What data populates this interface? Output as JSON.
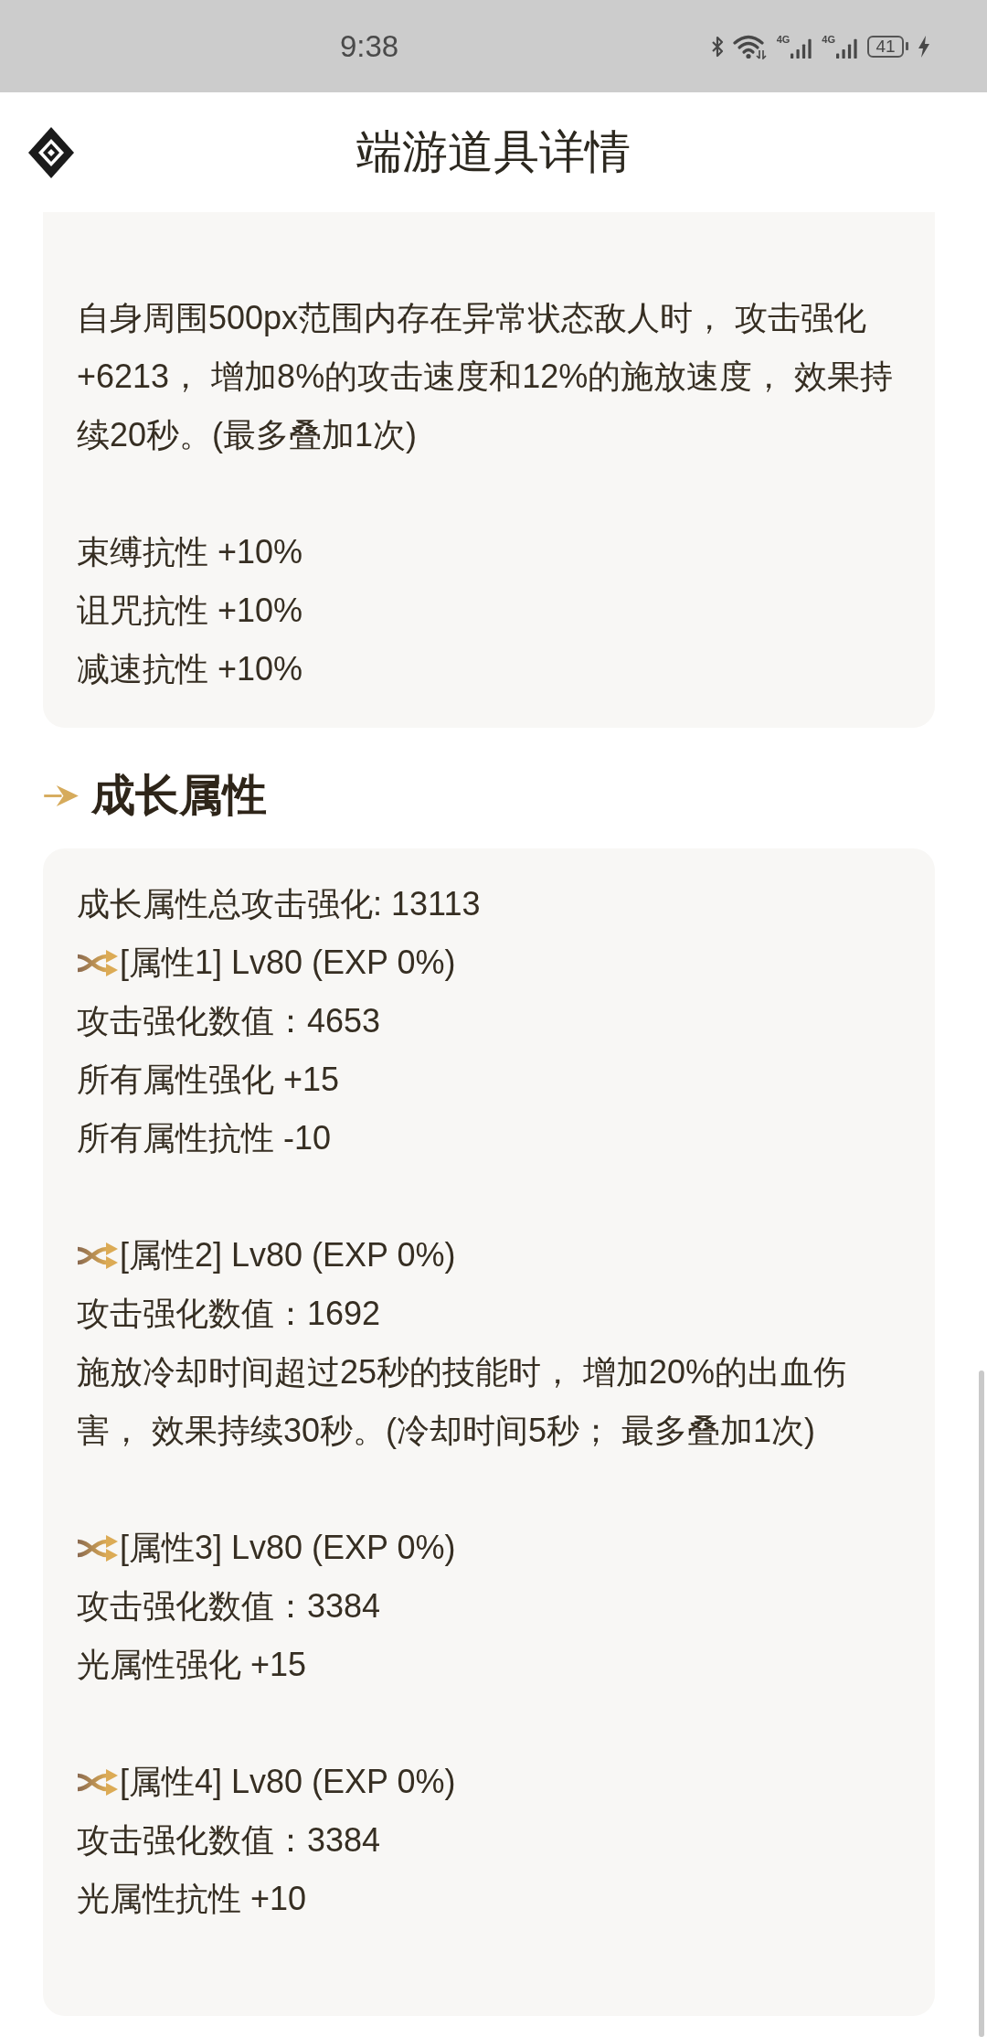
{
  "status_bar": {
    "time": "9:38",
    "signal_1_label": "4G",
    "signal_2_label": "4G",
    "battery": "41"
  },
  "header": {
    "title": "端游道具详情"
  },
  "effect_card": {
    "blocks": [
      {
        "lines": [
          "自身周围500px范围内存在异常状态敌人时， 攻击强化+6213， 增加8%的攻击速度和12%的施放速度， 效果持续20秒。(最多叠加1次)"
        ]
      },
      {
        "lines": [
          "束缚抗性 +10%",
          "诅咒抗性 +10%",
          "减速抗性 +10%"
        ]
      }
    ]
  },
  "growth_section": {
    "heading": "成长属性",
    "total": "成长属性总攻击强化: 13113",
    "attributes": [
      {
        "title": "[属性1] Lv80 (EXP 0%)",
        "lines": [
          "攻击强化数值：4653",
          "所有属性强化 +15",
          "所有属性抗性 -10"
        ]
      },
      {
        "title": "[属性2] Lv80 (EXP 0%)",
        "lines": [
          "攻击强化数值：1692",
          "施放冷却时间超过25秒的技能时， 增加20%的出血伤害， 效果持续30秒。(冷却时间5秒； 最多叠加1次)"
        ]
      },
      {
        "title": "[属性3] Lv80 (EXP 0%)",
        "lines": [
          "攻击强化数值：3384",
          "光属性强化 +15"
        ]
      },
      {
        "title": "[属性4] Lv80 (EXP 0%)",
        "lines": [
          "攻击强化数值：3384",
          "光属性抗性 +10"
        ]
      }
    ]
  }
}
